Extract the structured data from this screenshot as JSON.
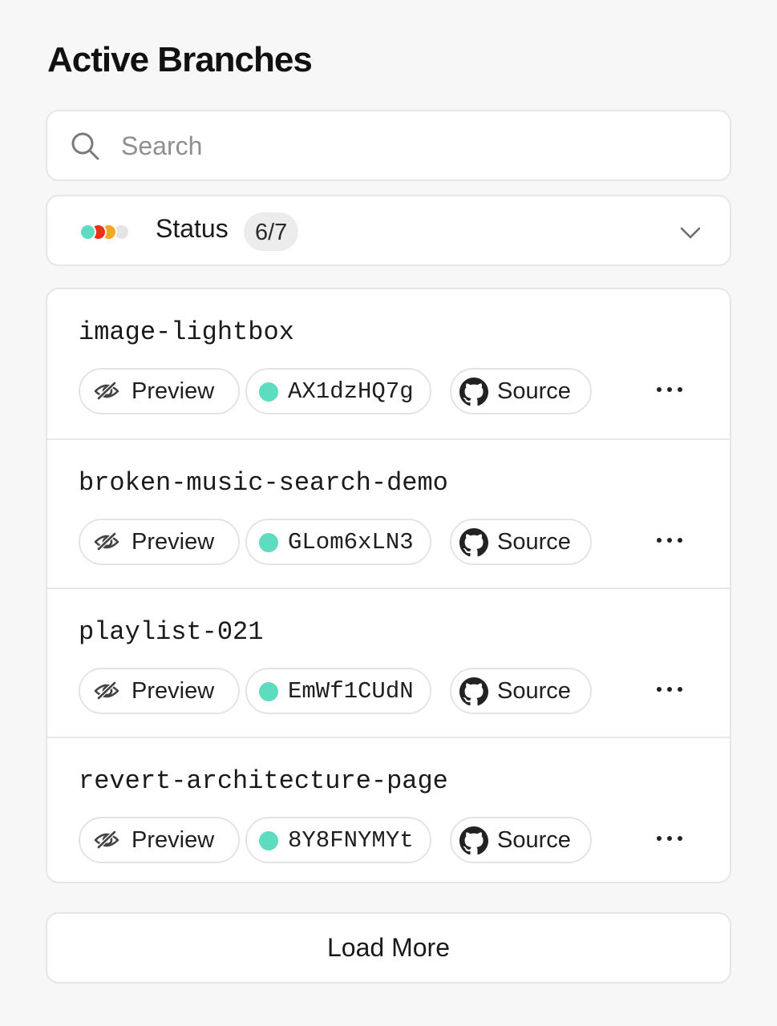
{
  "title": "Active Branches",
  "search": {
    "placeholder": "Search",
    "value": ""
  },
  "status_filter": {
    "label": "Status",
    "count": "6/7",
    "dot_colors": [
      "#5ddcc0",
      "#e8321c",
      "#f5a623",
      "#e4e4e4"
    ]
  },
  "branches": [
    {
      "name": "image-lightbox",
      "preview_label": "Preview",
      "deployment_id": "AX1dzHQ7g",
      "source_label": "Source"
    },
    {
      "name": "broken-music-search-demo",
      "preview_label": "Preview",
      "deployment_id": "GLom6xLN3",
      "source_label": "Source"
    },
    {
      "name": "playlist-021",
      "preview_label": "Preview",
      "deployment_id": "EmWf1CUdN",
      "source_label": "Source"
    },
    {
      "name": "revert-architecture-page",
      "preview_label": "Preview",
      "deployment_id": "8Y8FNYMYt",
      "source_label": "Source"
    }
  ],
  "load_more_label": "Load More",
  "colors": {
    "ready_dot": "#5ddcc0"
  },
  "icons": {
    "search": "search-icon",
    "chevron": "chevron-down-icon",
    "preview": "preview-eye-icon",
    "source": "github-icon",
    "more": "more-horizontal-icon"
  }
}
